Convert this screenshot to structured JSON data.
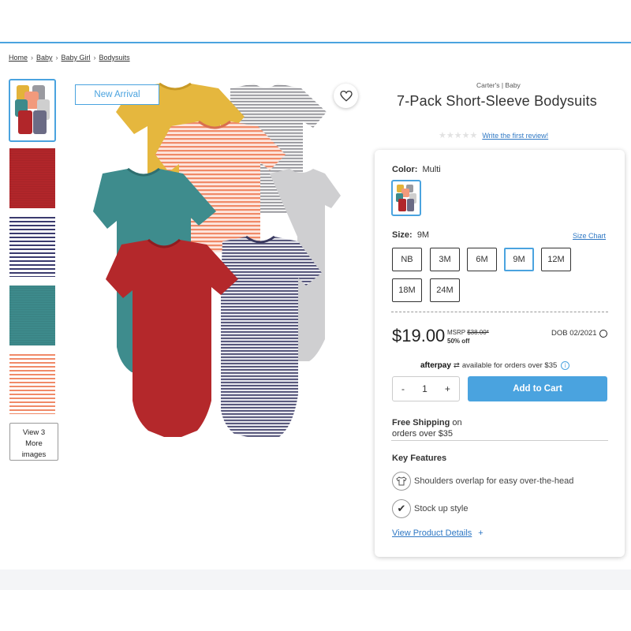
{
  "breadcrumb": [
    "Home",
    "Baby",
    "Baby Girl",
    "Bodysuits"
  ],
  "badge": "New Arrival",
  "view_more": [
    "View 3",
    "More",
    "images"
  ],
  "product": {
    "brand": "Carter's | Baby",
    "title": "7-Pack Short-Sleeve Bodysuits",
    "review_link": "Write the first review!"
  },
  "color": {
    "label": "Color:",
    "value": "Multi"
  },
  "size": {
    "label": "Size:",
    "value": "9M",
    "chart_link": "Size Chart",
    "options": [
      "NB",
      "3M",
      "6M",
      "9M",
      "12M",
      "18M",
      "24M"
    ],
    "selected": "9M"
  },
  "price": {
    "current": "$19.00",
    "msrp_label": "MSRP",
    "msrp_value": "$38.00*",
    "discount": "50% off",
    "dob": "DOB 02/2021"
  },
  "afterpay": {
    "logo": "afterpay",
    "text": "available for orders over $35"
  },
  "quantity": {
    "minus": "-",
    "value": "1",
    "plus": "+"
  },
  "add_to_cart": "Add to Cart",
  "shipping": {
    "bold": "Free Shipping",
    "rest": "on",
    "line2": "orders over $35"
  },
  "key_features": {
    "title": "Key Features",
    "items": [
      "Shoulders overlap for easy over-the-head",
      "Stock up style"
    ]
  },
  "details_link": "View Product Details",
  "details_plus": "+",
  "colors": {
    "accent": "#4aa3df",
    "link": "#2f78c4"
  }
}
